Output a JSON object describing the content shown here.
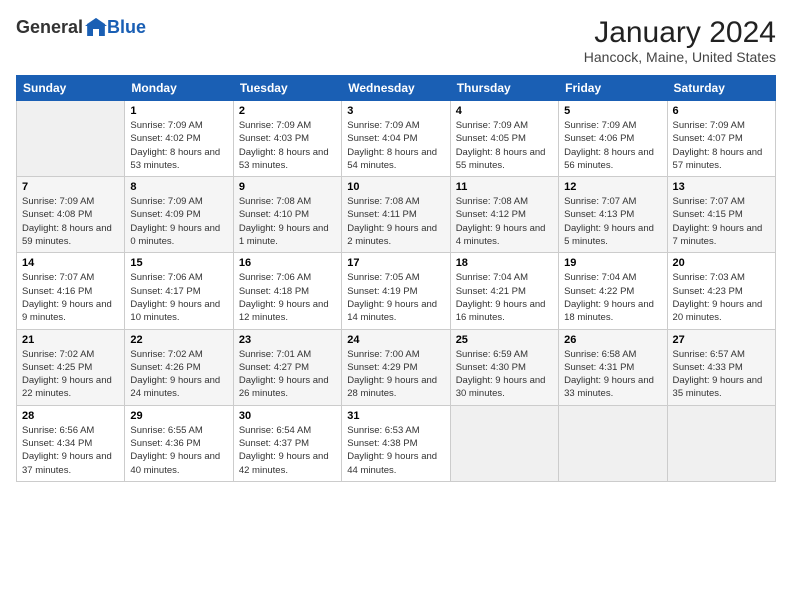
{
  "logo": {
    "general": "General",
    "blue": "Blue"
  },
  "header": {
    "title": "January 2024",
    "subtitle": "Hancock, Maine, United States"
  },
  "days_of_week": [
    "Sunday",
    "Monday",
    "Tuesday",
    "Wednesday",
    "Thursday",
    "Friday",
    "Saturday"
  ],
  "weeks": [
    {
      "days": [
        {
          "num": "",
          "empty": true
        },
        {
          "num": "1",
          "sunrise": "Sunrise: 7:09 AM",
          "sunset": "Sunset: 4:02 PM",
          "daylight": "Daylight: 8 hours and 53 minutes."
        },
        {
          "num": "2",
          "sunrise": "Sunrise: 7:09 AM",
          "sunset": "Sunset: 4:03 PM",
          "daylight": "Daylight: 8 hours and 53 minutes."
        },
        {
          "num": "3",
          "sunrise": "Sunrise: 7:09 AM",
          "sunset": "Sunset: 4:04 PM",
          "daylight": "Daylight: 8 hours and 54 minutes."
        },
        {
          "num": "4",
          "sunrise": "Sunrise: 7:09 AM",
          "sunset": "Sunset: 4:05 PM",
          "daylight": "Daylight: 8 hours and 55 minutes."
        },
        {
          "num": "5",
          "sunrise": "Sunrise: 7:09 AM",
          "sunset": "Sunset: 4:06 PM",
          "daylight": "Daylight: 8 hours and 56 minutes."
        },
        {
          "num": "6",
          "sunrise": "Sunrise: 7:09 AM",
          "sunset": "Sunset: 4:07 PM",
          "daylight": "Daylight: 8 hours and 57 minutes."
        }
      ]
    },
    {
      "days": [
        {
          "num": "7",
          "sunrise": "Sunrise: 7:09 AM",
          "sunset": "Sunset: 4:08 PM",
          "daylight": "Daylight: 8 hours and 59 minutes."
        },
        {
          "num": "8",
          "sunrise": "Sunrise: 7:09 AM",
          "sunset": "Sunset: 4:09 PM",
          "daylight": "Daylight: 9 hours and 0 minutes."
        },
        {
          "num": "9",
          "sunrise": "Sunrise: 7:08 AM",
          "sunset": "Sunset: 4:10 PM",
          "daylight": "Daylight: 9 hours and 1 minute."
        },
        {
          "num": "10",
          "sunrise": "Sunrise: 7:08 AM",
          "sunset": "Sunset: 4:11 PM",
          "daylight": "Daylight: 9 hours and 2 minutes."
        },
        {
          "num": "11",
          "sunrise": "Sunrise: 7:08 AM",
          "sunset": "Sunset: 4:12 PM",
          "daylight": "Daylight: 9 hours and 4 minutes."
        },
        {
          "num": "12",
          "sunrise": "Sunrise: 7:07 AM",
          "sunset": "Sunset: 4:13 PM",
          "daylight": "Daylight: 9 hours and 5 minutes."
        },
        {
          "num": "13",
          "sunrise": "Sunrise: 7:07 AM",
          "sunset": "Sunset: 4:15 PM",
          "daylight": "Daylight: 9 hours and 7 minutes."
        }
      ]
    },
    {
      "days": [
        {
          "num": "14",
          "sunrise": "Sunrise: 7:07 AM",
          "sunset": "Sunset: 4:16 PM",
          "daylight": "Daylight: 9 hours and 9 minutes."
        },
        {
          "num": "15",
          "sunrise": "Sunrise: 7:06 AM",
          "sunset": "Sunset: 4:17 PM",
          "daylight": "Daylight: 9 hours and 10 minutes."
        },
        {
          "num": "16",
          "sunrise": "Sunrise: 7:06 AM",
          "sunset": "Sunset: 4:18 PM",
          "daylight": "Daylight: 9 hours and 12 minutes."
        },
        {
          "num": "17",
          "sunrise": "Sunrise: 7:05 AM",
          "sunset": "Sunset: 4:19 PM",
          "daylight": "Daylight: 9 hours and 14 minutes."
        },
        {
          "num": "18",
          "sunrise": "Sunrise: 7:04 AM",
          "sunset": "Sunset: 4:21 PM",
          "daylight": "Daylight: 9 hours and 16 minutes."
        },
        {
          "num": "19",
          "sunrise": "Sunrise: 7:04 AM",
          "sunset": "Sunset: 4:22 PM",
          "daylight": "Daylight: 9 hours and 18 minutes."
        },
        {
          "num": "20",
          "sunrise": "Sunrise: 7:03 AM",
          "sunset": "Sunset: 4:23 PM",
          "daylight": "Daylight: 9 hours and 20 minutes."
        }
      ]
    },
    {
      "days": [
        {
          "num": "21",
          "sunrise": "Sunrise: 7:02 AM",
          "sunset": "Sunset: 4:25 PM",
          "daylight": "Daylight: 9 hours and 22 minutes."
        },
        {
          "num": "22",
          "sunrise": "Sunrise: 7:02 AM",
          "sunset": "Sunset: 4:26 PM",
          "daylight": "Daylight: 9 hours and 24 minutes."
        },
        {
          "num": "23",
          "sunrise": "Sunrise: 7:01 AM",
          "sunset": "Sunset: 4:27 PM",
          "daylight": "Daylight: 9 hours and 26 minutes."
        },
        {
          "num": "24",
          "sunrise": "Sunrise: 7:00 AM",
          "sunset": "Sunset: 4:29 PM",
          "daylight": "Daylight: 9 hours and 28 minutes."
        },
        {
          "num": "25",
          "sunrise": "Sunrise: 6:59 AM",
          "sunset": "Sunset: 4:30 PM",
          "daylight": "Daylight: 9 hours and 30 minutes."
        },
        {
          "num": "26",
          "sunrise": "Sunrise: 6:58 AM",
          "sunset": "Sunset: 4:31 PM",
          "daylight": "Daylight: 9 hours and 33 minutes."
        },
        {
          "num": "27",
          "sunrise": "Sunrise: 6:57 AM",
          "sunset": "Sunset: 4:33 PM",
          "daylight": "Daylight: 9 hours and 35 minutes."
        }
      ]
    },
    {
      "days": [
        {
          "num": "28",
          "sunrise": "Sunrise: 6:56 AM",
          "sunset": "Sunset: 4:34 PM",
          "daylight": "Daylight: 9 hours and 37 minutes."
        },
        {
          "num": "29",
          "sunrise": "Sunrise: 6:55 AM",
          "sunset": "Sunset: 4:36 PM",
          "daylight": "Daylight: 9 hours and 40 minutes."
        },
        {
          "num": "30",
          "sunrise": "Sunrise: 6:54 AM",
          "sunset": "Sunset: 4:37 PM",
          "daylight": "Daylight: 9 hours and 42 minutes."
        },
        {
          "num": "31",
          "sunrise": "Sunrise: 6:53 AM",
          "sunset": "Sunset: 4:38 PM",
          "daylight": "Daylight: 9 hours and 44 minutes."
        },
        {
          "num": "",
          "empty": true
        },
        {
          "num": "",
          "empty": true
        },
        {
          "num": "",
          "empty": true
        }
      ]
    }
  ]
}
